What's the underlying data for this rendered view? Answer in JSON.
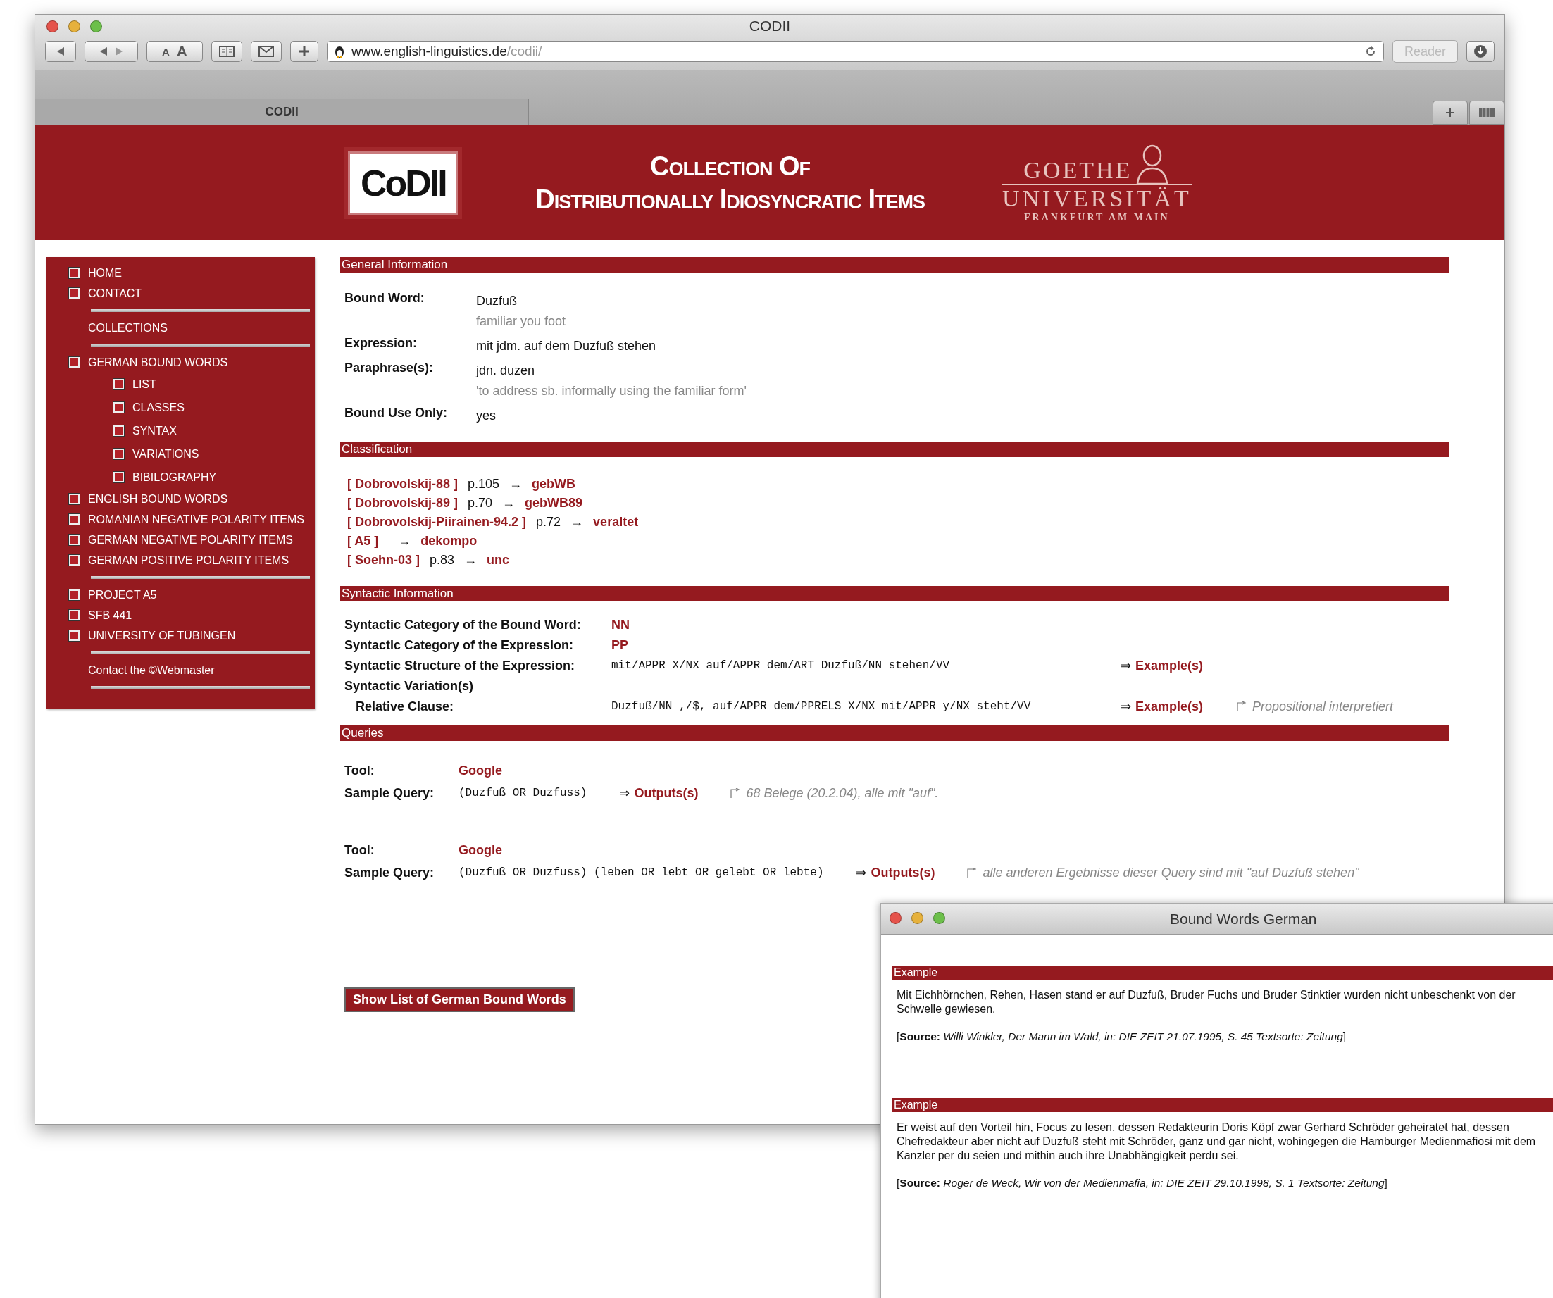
{
  "browser": {
    "title": "CODII",
    "font_smaller": "A",
    "font_larger": "A",
    "url_host": "www.english-linguistics.de",
    "url_path": "/codii/",
    "reader": "Reader",
    "tab": "CODII"
  },
  "header": {
    "logo": "CoDII",
    "title_line1": "Collection Of",
    "title_line2": "Distributionally Idiosyncratic Items",
    "university": "GOETHE",
    "university_line2": "UNIVERSITÄT",
    "university_line3": "FRANKFURT AM MAIN"
  },
  "sidebar": {
    "groups": [
      [
        {
          "label": "HOME",
          "kind": "bullet"
        },
        {
          "label": "CONTACT",
          "kind": "bullet"
        }
      ],
      [
        {
          "label": "COLLECTIONS",
          "kind": "plain"
        }
      ],
      [
        {
          "label": "GERMAN BOUND WORDS",
          "kind": "bullet",
          "children": [
            {
              "label": "LIST",
              "kind": "bullet"
            },
            {
              "label": "CLASSES",
              "kind": "bullet"
            },
            {
              "label": "SYNTAX",
              "kind": "bullet"
            },
            {
              "label": "VARIATIONS",
              "kind": "bullet"
            },
            {
              "label": "BIBILOGRAPHY",
              "kind": "bullet"
            }
          ]
        },
        {
          "label": "ENGLISH BOUND WORDS",
          "kind": "bullet"
        },
        {
          "label": "ROMANIAN NEGATIVE POLARITY ITEMS",
          "kind": "bullet"
        },
        {
          "label": "GERMAN NEGATIVE POLARITY ITEMS",
          "kind": "bullet"
        },
        {
          "label": "GERMAN POSITIVE POLARITY ITEMS",
          "kind": "bullet"
        }
      ],
      [
        {
          "label": "PROJECT A5",
          "kind": "bullet"
        },
        {
          "label": "SFB 441",
          "kind": "bullet"
        },
        {
          "label": "UNIVERSITY OF TÜBINGEN",
          "kind": "bullet"
        }
      ],
      [
        {
          "label": "Contact the ©Webmaster",
          "kind": "plain"
        }
      ]
    ]
  },
  "general": {
    "title": "General Information",
    "rows": [
      {
        "label": "Bound Word:",
        "value": "Duzfuß",
        "gloss": "familiar you foot"
      },
      {
        "label": "Expression:",
        "value": "mit jdm. auf dem Duzfuß stehen"
      },
      {
        "label": "Paraphrase(s):",
        "value": "jdn. duzen",
        "gloss": "'to address sb. informally using the familiar form'"
      },
      {
        "label": "Bound Use Only:",
        "value": "yes"
      }
    ]
  },
  "classification": {
    "title": "Classification",
    "rows": [
      {
        "source": "[ Dobrovolskij-88 ]",
        "page": "p.105",
        "arrow": "→",
        "class": "gebWB"
      },
      {
        "source": "[ Dobrovolskij-89 ]",
        "page": "p.70",
        "arrow": "→",
        "class": "gebWB89"
      },
      {
        "source": "[ Dobrovolskij-Piirainen-94.2 ]",
        "page": "p.72",
        "arrow": "→",
        "class": "veraltet"
      },
      {
        "source": "[ A5 ]",
        "arrow": "→",
        "class": "dekompo"
      },
      {
        "source": "[ Soehn-03 ]",
        "page": "p.83",
        "arrow": "→",
        "class": "unc"
      }
    ]
  },
  "syntax": {
    "title": "Syntactic Information",
    "rows": [
      {
        "kind": "category",
        "label": "Syntactic Category of the Bound Word:",
        "value": "NN"
      },
      {
        "kind": "category",
        "label": "Syntactic Category of the Expression:",
        "value": "PP"
      },
      {
        "kind": "structure",
        "label": "Syntactic Structure of the Expression:",
        "value": "mit/APPR X/NX auf/APPR dem/ART Duzfuß/NN stehen/VV",
        "arrow": "⇒",
        "link": "Example(s)"
      },
      {
        "kind": "heading",
        "label": "Syntactic Variation(s)"
      },
      {
        "kind": "variation",
        "label": "Relative Clause:",
        "value": "Duzfuß/NN ,/$, auf/APPR dem/PPRELS X/NX mit/APPR y/NX steht/VV",
        "arrow": "⇒",
        "link": "Example(s)",
        "note": "Propositional interpretiert"
      }
    ]
  },
  "queries": {
    "title": "Queries",
    "items": [
      {
        "tool_label": "Tool:",
        "tool": "Google",
        "query_label": "Sample Query:",
        "query": "(Duzfuß OR Duzfuss)",
        "arrow": "⇒",
        "link": "Outputs(s)",
        "note": "68 Belege (20.2.04), alle mit \"auf\"."
      },
      {
        "tool_label": "Tool:",
        "tool": "Google",
        "query_label": "Sample Query:",
        "query": "(Duzfuß OR Duzfuss) (leben OR lebt OR gelebt OR lebte)",
        "arrow": "⇒",
        "link": "Outputs(s)",
        "note": "alle anderen Ergebnisse dieser Query sind mit \"auf Duzfuß stehen\""
      }
    ]
  },
  "list_button": "Show List of German Bound Words",
  "popup": {
    "title": "Bound Words German",
    "examples": [
      {
        "heading": "Example",
        "text": "Mit Eichhörnchen, Rehen, Hasen stand er auf Duzfuß, Bruder Fuchs und Bruder Stinktier wurden nicht unbeschenkt von der Schwelle gewiesen.",
        "source": "[**Source:** *Willi Winkler, Der Mann im Wald, in: DIE ZEIT 21.07.1995, S. 45 Textsorte: Zeitung*]"
      },
      {
        "heading": "Example",
        "text": "Er weist auf den Vorteil hin, Focus zu lesen, dessen Redakteurin Doris Köpf zwar Gerhard Schröder geheiratet hat, dessen Chefredakteur aber nicht auf Duzfuß steht mit Schröder, ganz und gar nicht, wohingegen die Hamburger Medienmafiosi mit dem Kanzler per du seien und mithin auch ihre Unabhängigkeit perdu sei.",
        "source": "[**Source:** *Roger de Weck, Wir von der Medienmafia, in: DIE ZEIT 29.10.1998, S. 1 Textsorte: Zeitung*]"
      }
    ]
  }
}
